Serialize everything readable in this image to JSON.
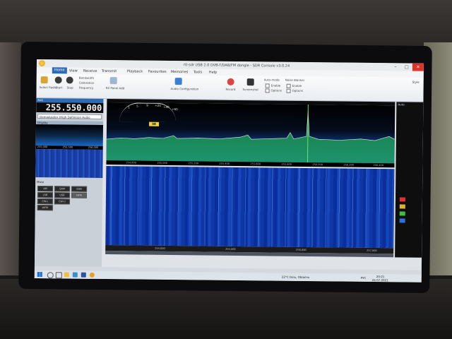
{
  "window": {
    "title": "rtl-sdr USB 2.0 DVB-T/DAB/FM dongle - SDR Console v3.0.24"
  },
  "ribbon": {
    "tabs": [
      "Home",
      "View",
      "Receive",
      "Transmit",
      "Playback",
      "Favourites",
      "Memories",
      "Tools",
      "Help"
    ],
    "active_tab": "Home",
    "buttons": [
      "Select Radio",
      "Start",
      "Stop",
      "Bandwidth",
      "Calibration",
      "Frequency",
      "RX Panel Add",
      "Audio Configuration",
      "Record",
      "Screenshot"
    ],
    "auto_mode_label": "Auto-mode",
    "noise_blanker_label": "Noise Blanker",
    "enable_label": "Enable",
    "options_label": "Options",
    "style_label": "Style"
  },
  "left_panel": {
    "header": "Rx1",
    "frequency": "255.550.000",
    "demod": "Demodulator (High Definition Audio Device)",
    "mini_header": "Display",
    "mini_axis": [
      "255,000",
      "255,500",
      "256,000"
    ],
    "mute_label": "Mute",
    "modes": [
      "AM",
      "SAM",
      "DSB",
      "LSB",
      "USB",
      "NFM",
      "CW-L",
      "CW-U",
      "WFM"
    ]
  },
  "smeter": {
    "value": "58",
    "scale": [
      "S",
      "1",
      "5",
      "9",
      "+20",
      "+40",
      "+60"
    ]
  },
  "spectrum": {
    "axis_labels": [
      "254,800",
      "255,000",
      "255,200",
      "255,400",
      "255,600",
      "255,800",
      "256,000",
      "256,200",
      "256,400"
    ]
  },
  "waterfall": {
    "axis_labels": [
      "254,000",
      "255,000",
      "256,000",
      "257,000"
    ]
  },
  "right_bar": {
    "label": "Auto"
  },
  "taskbar": {
    "weather": "22°C Dolu, Oblačno",
    "language": "РУС",
    "time": "20:21",
    "date": "24.07.2021"
  },
  "colors": {
    "accent": "#2e6bb5",
    "close": "#d9352c",
    "meter": "#f0d23a"
  }
}
